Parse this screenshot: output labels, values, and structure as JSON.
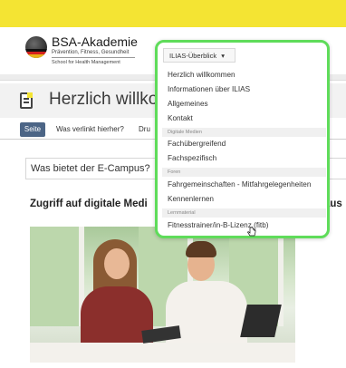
{
  "brand": {
    "name": "BSA-Akademie",
    "tagline": "Prävention, Fitness, Gesundheit",
    "school": "School for Health Management"
  },
  "page": {
    "title": "Herzlich willkommen"
  },
  "tabs": [
    "Seite",
    "Was verlinkt hierher?",
    "Dru"
  ],
  "content": {
    "section_title": "Was bietet der E-Campus?",
    "heading": "Zugriff auf digitale Medi",
    "heading_tail": "aus"
  },
  "dropdown": {
    "toggle_label": "ILIAS-Überblick",
    "caret": "▾",
    "items": [
      {
        "kind": "item",
        "label": "Herzlich willkommen"
      },
      {
        "kind": "item",
        "label": "Informationen über ILIAS"
      },
      {
        "kind": "item",
        "label": "Allgemeines"
      },
      {
        "kind": "item",
        "label": "Kontakt"
      },
      {
        "kind": "header",
        "label": "Digitale Medien"
      },
      {
        "kind": "item",
        "label": "Fachübergreifend"
      },
      {
        "kind": "item",
        "label": "Fachspezifisch"
      },
      {
        "kind": "header",
        "label": "Foren"
      },
      {
        "kind": "item",
        "label": "Fahrgemeinschaften - Mitfahrgelegenheiten"
      },
      {
        "kind": "item",
        "label": "Kennenlernen"
      },
      {
        "kind": "header",
        "label": "Lernmaterial"
      },
      {
        "kind": "item",
        "label": "Fitnesstrainer/in-B-Lizenz (fitb)"
      }
    ]
  },
  "colors": {
    "topbar": "#f4e433",
    "tab_active": "#4c6586",
    "highlight": "#5fdc5a"
  }
}
